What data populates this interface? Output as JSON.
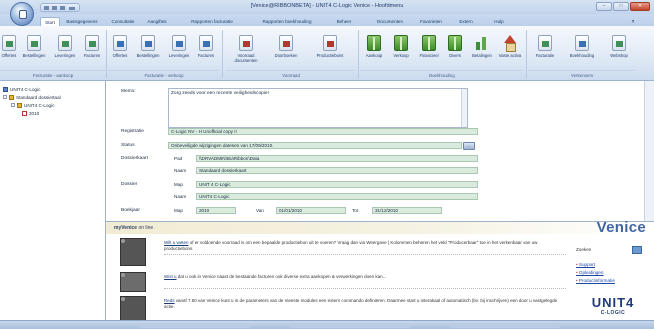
{
  "window": {
    "title": "[Venice@RIBBONBETA] - UNIT4 C-Logic Venice - Hoofdmenu",
    "buttons": {
      "minimize": "–",
      "maximize": "□",
      "close": "✕"
    }
  },
  "tabs": [
    {
      "label": "Start",
      "active": true
    },
    {
      "label": "Basisgegevens"
    },
    {
      "label": "Consultatie"
    },
    {
      "label": "Aangiftes"
    },
    {
      "label": "Rapporten facturatie"
    },
    {
      "label": "Rapporten boekhouding"
    },
    {
      "label": "Beheer"
    },
    {
      "label": "Documenten"
    },
    {
      "label": "Favorieten"
    },
    {
      "label": "Extern"
    },
    {
      "label": "Hulp"
    }
  ],
  "ribbon": {
    "buttons": [
      {
        "label": "Offertes",
        "icon": "document-icon"
      },
      {
        "label": "Bestellingen",
        "icon": "document-icon"
      },
      {
        "label": "Leveringen",
        "icon": "document-icon"
      },
      {
        "label": "Facturen",
        "icon": "document-icon"
      },
      {
        "label": "Offertes",
        "icon": "document-icon"
      },
      {
        "label": "Bestellingen",
        "icon": "document-icon"
      },
      {
        "label": "Leveringen",
        "icon": "document-icon"
      },
      {
        "label": "Facturen",
        "icon": "document-icon"
      },
      {
        "label": "Voorraad documenten",
        "icon": "document-icon"
      },
      {
        "label": "Doorboeken",
        "icon": "document-icon"
      },
      {
        "label": "Productiebons",
        "icon": "document-icon"
      },
      {
        "label": "Aankoop",
        "icon": "book-icon"
      },
      {
        "label": "Verkoop",
        "icon": "book-icon"
      },
      {
        "label": "Financieel",
        "icon": "book-icon"
      },
      {
        "label": "Divers",
        "icon": "book-icon"
      },
      {
        "label": "Betalingen",
        "icon": "chart-icon"
      },
      {
        "label": "Vaste activa",
        "icon": "house-icon"
      },
      {
        "label": "Facturatie",
        "icon": "document-icon"
      },
      {
        "label": "Boekhouding",
        "icon": "document-icon"
      },
      {
        "label": "Webshop",
        "icon": "document-icon"
      }
    ],
    "groups": [
      "Facturatie - aankoop",
      "Facturatie - verkoop",
      "Voorraad",
      "Boekhouding",
      "Verkenners"
    ]
  },
  "tree": {
    "root": "UNIT4 C-Logic",
    "folder": "Standaard dossiertaal",
    "dossier": "UNIT4 C-Logic",
    "year": "2010"
  },
  "form": {
    "memo_label": "Memo:",
    "memo_text": "Zorg zeeds voor een recente veiligheidscopie!",
    "registratie_label": "Registratie",
    "registratie_value": "C-Logic NV - H Unofficial copy !!",
    "status_label": "Status",
    "status_value": "Onbeveiligde wijzigingen datesen van 17/09/2010.",
    "status_button": "...",
    "dossierkaart_label": "Dossierkaart",
    "pad_label": "Pad",
    "pad_value": "\\\\DRVADMIN\\Bu\\Ribbon\\Data",
    "naam_label": "Naam",
    "naam_value": "Standaard dossierkaart",
    "dossier_label": "Dossier",
    "map_label": "Map",
    "map_value": "UNIT 4 C-Logic",
    "dossier_naam_label": "Naam",
    "dossier_naam_value": "UNIT4 C-Logic",
    "boekjaar_label": "Boekjaar",
    "boekjaar_map_label": "Map",
    "boekjaar_map_value": "2010",
    "van_label": "Van",
    "van_value": "01/01/2010",
    "tot_label": "Tot",
    "tot_value": "31/12/2010"
  },
  "online": {
    "header_prefix": "myVenice",
    "header_suffix": " on line",
    "brand": "Venice",
    "tips": [
      {
        "link": "Wilt u weten",
        "text": " of er voldoende voorraad is om een bepaalde productiebon uit te voeren? Vraag dan via Weergave | Kolommen beheren het veld \"Producerbaar\" toe in het verkenbaar van uw productiebons."
      },
      {
        "link": "Wist u",
        "text": " dat u ook in Venice naast de bestaande facturen ook diverse extra aankopen & verwerkingen doen kan..."
      },
      {
        "link": "Reds",
        "text": " vanaf 7.60 van Venice kunt u in de parameters van de meeste modules een extern commando definiëren. Daarmee start u interakaal of automatisch (bv. bij inschrijven) een door u vastgelegde actie."
      }
    ],
    "search_label": "Zoeken",
    "links": [
      "Support",
      "Opleidingen",
      "Productinformatie"
    ],
    "logo_main": "UNIT4",
    "logo_sub": "C-LOGIC"
  }
}
